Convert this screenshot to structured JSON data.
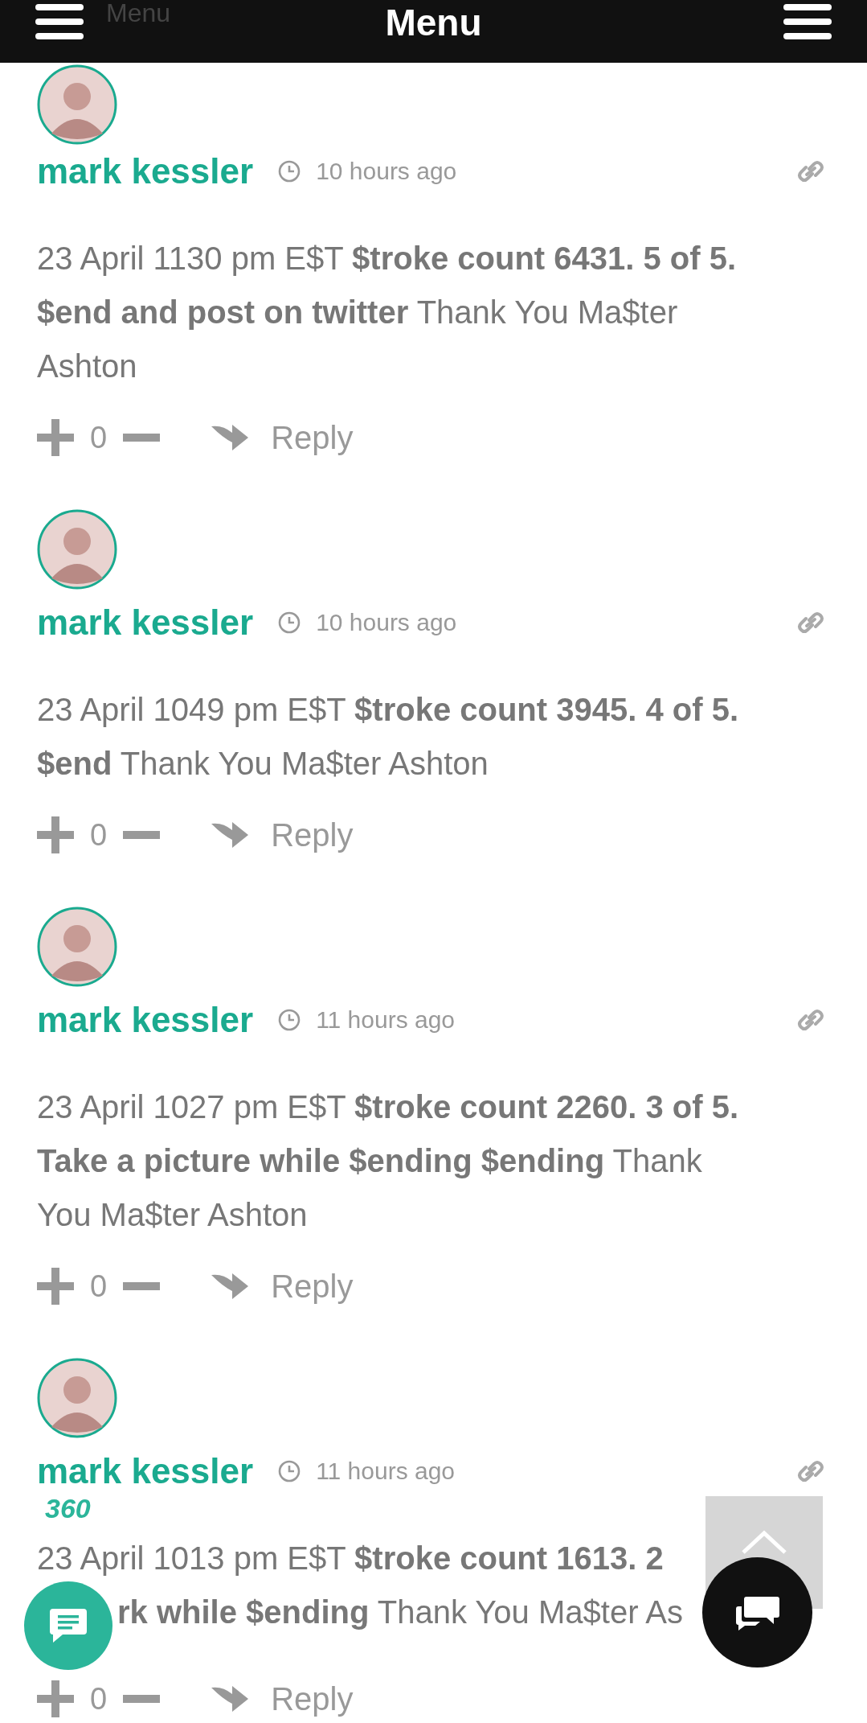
{
  "header": {
    "ghost_label": "Menu",
    "title": "Menu"
  },
  "comments": [
    {
      "author": "mark kessler",
      "time": "10 hours ago",
      "body": "23 April 1130 pm E$T **$troke count 6431. 5 of 5.  $end and post on twitter** Thank You Ma$ter Ashton",
      "votes": "0",
      "reply": "Reply"
    },
    {
      "author": "mark kessler",
      "time": "10 hours ago",
      "body": "23 April 1049 pm E$T **$troke count 3945. 4 of 5.  $end** Thank You Ma$ter Ashton",
      "votes": "0",
      "reply": "Reply"
    },
    {
      "author": "mark kessler",
      "time": "11 hours ago",
      "body": "23 April 1027 pm E$T **$troke count 2260. 3 of 5.  Take a picture while $ending $ending** Thank You Ma$ter Ashton",
      "votes": "0",
      "reply": "Reply"
    },
    {
      "author": "mark kessler",
      "time": "11 hours ago",
      "body_lines": [
        "23 April 1013 pm E$T **$troke count 1613. 2**",
        "**rk while $ending** Thank You Ma$ter As"
      ],
      "votes": "0",
      "reply": "Reply"
    }
  ],
  "badge": "360"
}
